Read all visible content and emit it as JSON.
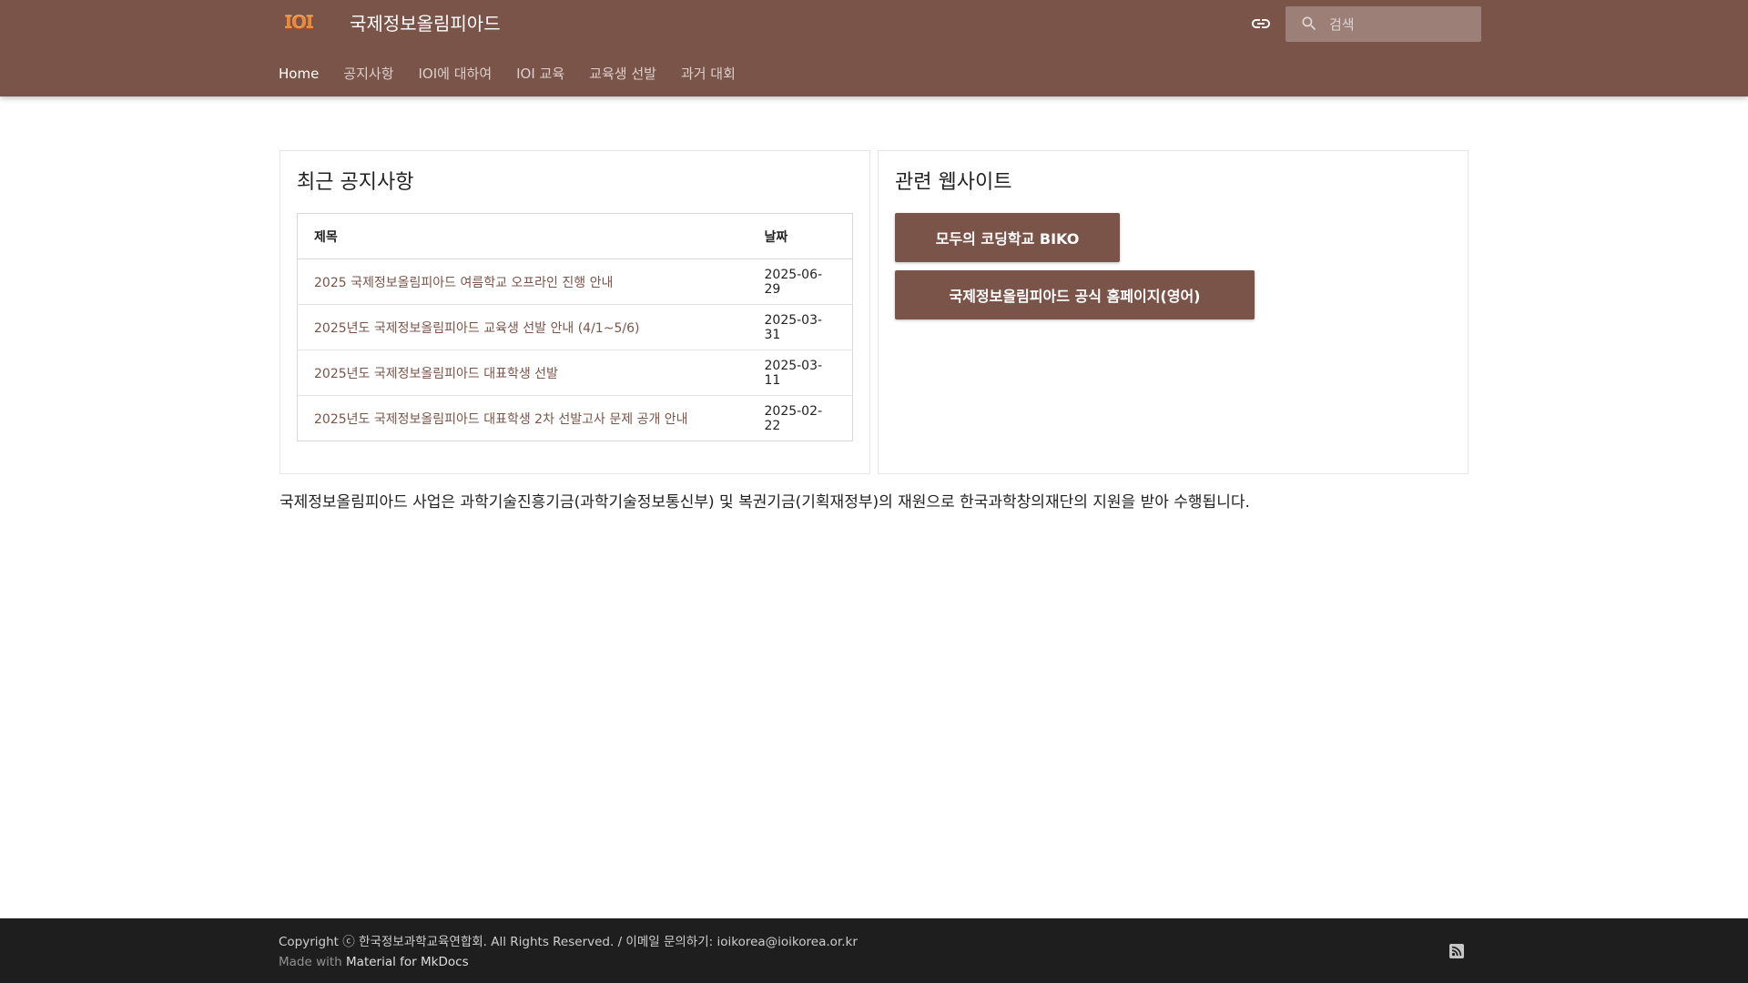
{
  "header": {
    "logo_text": "IOI",
    "site_title": "국제정보올림피아드",
    "search_placeholder": "검색",
    "link_icon": "link-icon",
    "search_icon": "search-icon"
  },
  "nav": {
    "tabs": [
      {
        "label": "Home",
        "active": true
      },
      {
        "label": "공지사항",
        "active": false
      },
      {
        "label": "IOI에 대하여",
        "active": false
      },
      {
        "label": "IOI 교육",
        "active": false
      },
      {
        "label": "교육생 선발",
        "active": false
      },
      {
        "label": "과거 대회",
        "active": false
      }
    ]
  },
  "notices": {
    "heading": "최근 공지사항",
    "columns": [
      "제목",
      "날짜"
    ],
    "rows": [
      {
        "title": "2025 국제정보올림피아드 여름학교 오프라인 진행 안내",
        "date": "2025-06-29"
      },
      {
        "title": "2025년도 국제정보올림피아드 교육생 선발 안내 (4/1~5/6)",
        "date": "2025-03-31"
      },
      {
        "title": "2025년도 국제정보올림피아드 대표학생 선발",
        "date": "2025-03-11"
      },
      {
        "title": "2025년도 국제정보올림피아드 대표학생 2차 선발고사 문제 공개 안내",
        "date": "2025-02-22"
      }
    ]
  },
  "related": {
    "heading": "관련 웹사이트",
    "buttons": [
      "모두의 코딩학교 BIKO",
      "국제정보올림피아드 공식 홈페이지(영어)"
    ]
  },
  "funding_text": "국제정보올림피아드 사업은 과학기술진흥기금(과학기술정보통신부) 및 복권기금(기획재정부)의 재원으로 한국과학창의재단의 지원을 받아 수행됩니다.",
  "footer": {
    "copyright": "Copyright ⓒ 한국정보과학교육연합회. All Rights Reserved. / 이메일 문의하기: ioikorea@ioikorea.or.kr",
    "made_with": "Made with",
    "made_with_link": "Material for MkDocs",
    "rss_icon": "rss-icon"
  },
  "colors": {
    "primary": "#7a5448",
    "footer_bg": "#1e1e1e"
  }
}
